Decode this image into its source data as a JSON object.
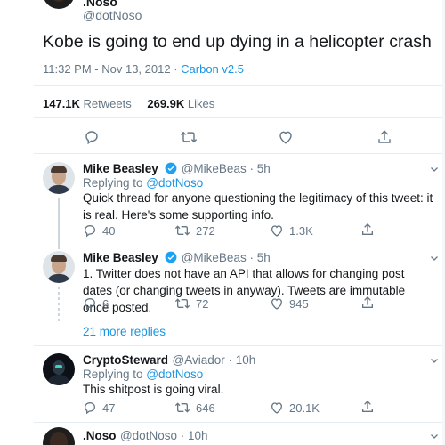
{
  "colors": {
    "accent": "#1b95e0",
    "text": "#14171a",
    "secondary": "#657786",
    "divider": "#e6ecf0"
  },
  "main_tweet": {
    "display_name": ".Noso",
    "handle": "@dotNoso",
    "text": "Kobe is going to end up dying in a helicopter crash",
    "timestamp": "11:32 PM - Nov 13, 2012",
    "separator": " · ",
    "client": "Carbon v2.5",
    "retweets_count": "147.1K",
    "retweets_label": " Retweets",
    "likes_count": "269.9K",
    "likes_label": " Likes",
    "actions": [
      "reply-icon",
      "retweet-icon",
      "like-icon",
      "share-icon"
    ]
  },
  "replies": [
    {
      "display_name": "Mike Beasley",
      "verified": true,
      "handle": "@MikeBeas",
      "time": "5h",
      "text": "Quick thread for anyone questioning the legitimacy of this tweet: it is real. Here's some supporting info.",
      "reply_count": "40",
      "retweet_count": "272",
      "like_count": "1.3K"
    },
    {
      "display_name": "Mike Beasley",
      "verified": true,
      "handle": "@MikeBeas",
      "time": "5h",
      "text": "1. Twitter does not have an API that allows for changing post dates (or changing tweets in anyway). Tweets are immutable once posted.",
      "reply_count": "6",
      "retweet_count": "72",
      "like_count": "945"
    },
    {
      "display_name": "CryptoSteward",
      "verified": false,
      "handle": "@Aviador",
      "time": "10h",
      "replying_prefix": "Replying to ",
      "replying_to": "@dotNoso",
      "text": "This shitpost is going viral.",
      "reply_count": "47",
      "retweet_count": "646",
      "like_count": "20.1K"
    },
    {
      "display_name": ".Noso",
      "verified": false,
      "handle": "@dotNoso",
      "time": "10h"
    }
  ],
  "first_reply_replying_prefix": "Replying to ",
  "first_reply_replying_to": "@dotNoso",
  "more_replies": "21 more replies",
  "dot": " · "
}
